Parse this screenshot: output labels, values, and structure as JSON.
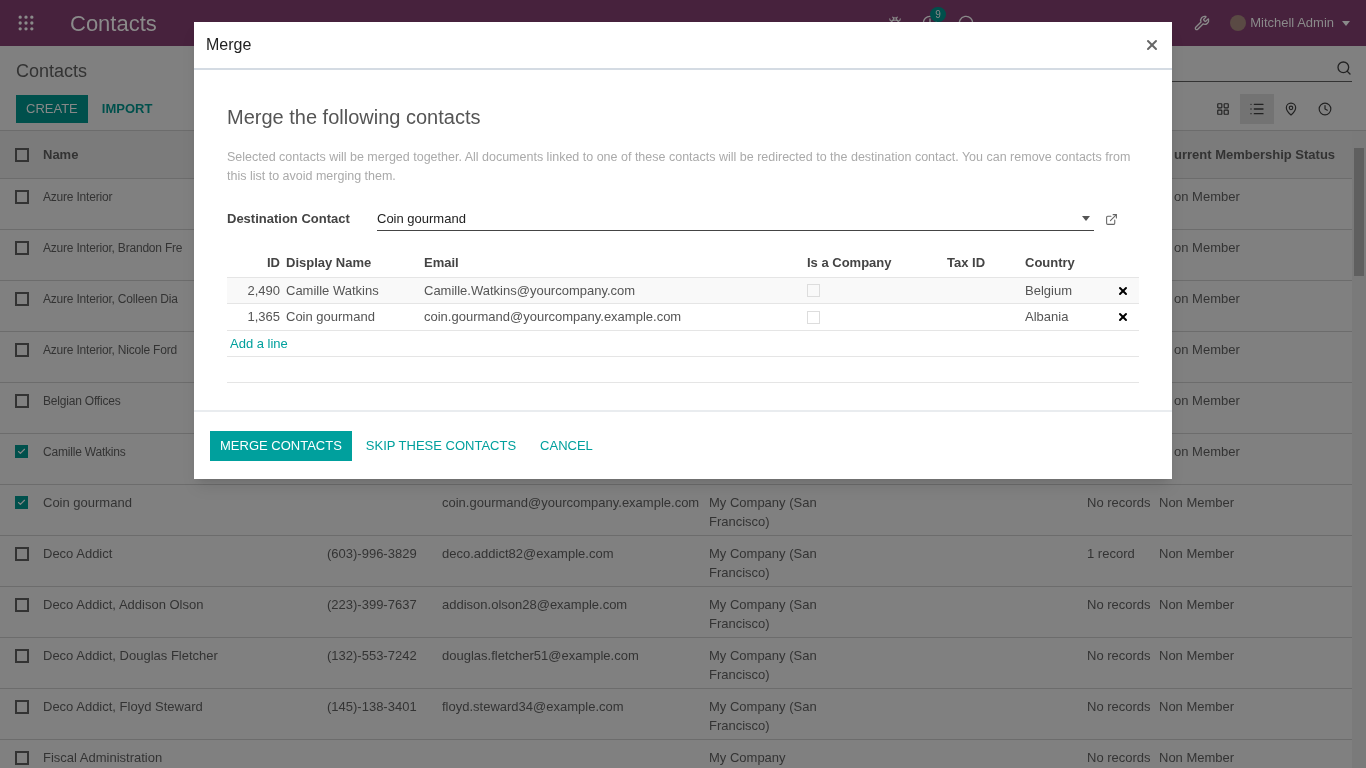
{
  "navbar": {
    "app_title": "Contacts",
    "activity_badge": "9",
    "user": "Mitchell Admin"
  },
  "control_panel": {
    "breadcrumb": "Contacts",
    "buttons": [
      "CREATE",
      "IMPORT"
    ],
    "views": [
      {
        "kind": "kanban",
        "selected": false
      },
      {
        "kind": "list",
        "selected": true
      },
      {
        "kind": "map",
        "selected": false
      },
      {
        "kind": "activity",
        "selected": false
      }
    ]
  },
  "list": {
    "columns": [
      "Name",
      "urrent Membership Status"
    ],
    "all_selected": false,
    "rows": [
      {
        "name": "Azure Interior",
        "status": "on Member",
        "checked": false
      },
      {
        "name": "Azure Interior, Brandon Fre",
        "status": "on Member",
        "checked": false
      },
      {
        "name": "Azure Interior, Colleen Dia",
        "status": "on Member",
        "checked": false
      },
      {
        "name": "Azure Interior, Nicole Ford",
        "status": "on Member",
        "checked": false
      },
      {
        "name": "Belgian Offices",
        "status": "on Member",
        "checked": false
      },
      {
        "name": "Camille Watkins",
        "status": "on Member",
        "checked": true
      },
      {
        "name": "Coin gourmand",
        "phone": "",
        "email": "coin.gourmand@yourcompany.example.com",
        "company": "My Company (San Francisco)",
        "records": "No records",
        "status": "Non Member",
        "checked": true
      },
      {
        "name": "Deco Addict",
        "phone": "(603)-996-3829",
        "email": "deco.addict82@example.com",
        "company": "My Company (San Francisco)",
        "records": "1 record",
        "status": "Non Member",
        "checked": false
      },
      {
        "name": "Deco Addict, Addison Olson",
        "phone": "(223)-399-7637",
        "email": "addison.olson28@example.com",
        "company": "My Company (San Francisco)",
        "records": "No records",
        "status": "Non Member",
        "checked": false
      },
      {
        "name": "Deco Addict, Douglas Fletcher",
        "phone": "(132)-553-7242",
        "email": "douglas.fletcher51@example.com",
        "company": "My Company (San Francisco)",
        "records": "No records",
        "status": "Non Member",
        "checked": false
      },
      {
        "name": "Deco Addict, Floyd Steward",
        "phone": "(145)-138-3401",
        "email": "floyd.steward34@example.com",
        "company": "My Company (San Francisco)",
        "records": "No records",
        "status": "Non Member",
        "checked": false
      },
      {
        "name": "Fiscal Administration",
        "phone": "",
        "email": "",
        "company": "My Company",
        "records": "No records",
        "status": "Non Member",
        "checked": false
      }
    ]
  },
  "dialog": {
    "title": "Merge",
    "heading": "Merge the following contacts",
    "description": "Selected contacts will be merged together. All documents linked to one of these contacts will be redirected to the destination contact. You can remove contacts from this list to avoid merging them.",
    "destination_label": "Destination Contact",
    "destination_value": "Coin gourmand",
    "columns": [
      "ID",
      "Display Name",
      "Email",
      "Is a Company",
      "Tax ID",
      "Country"
    ],
    "rows": [
      {
        "id": "2,490",
        "name": "Camille Watkins",
        "email": "Camille.Watkins@yourcompany.com",
        "is_company": false,
        "tax_id": "",
        "country": "Belgium"
      },
      {
        "id": "1,365",
        "name": "Coin gourmand",
        "email": "coin.gourmand@yourcompany.example.com",
        "is_company": false,
        "tax_id": "",
        "country": "Albania"
      }
    ],
    "add_line": "Add a line",
    "buttons": [
      {
        "label": "MERGE CONTACTS",
        "primary": true
      },
      {
        "label": "SKIP THESE CONTACTS",
        "primary": false
      },
      {
        "label": "CANCEL",
        "primary": false
      }
    ]
  }
}
